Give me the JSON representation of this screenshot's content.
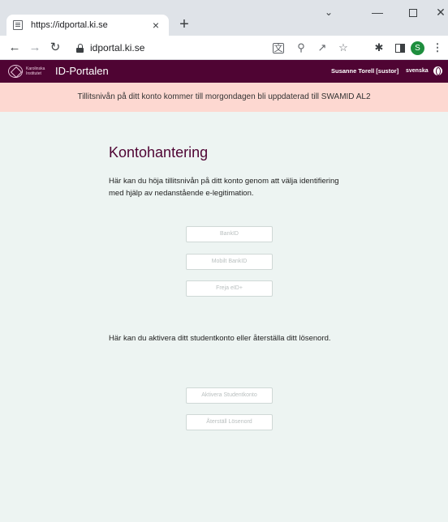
{
  "browser": {
    "tab_title": "https://idportal.ki.se",
    "tab_close": "×",
    "new_tab": "+",
    "url": "idportal.ki.se",
    "avatar_initial": "S"
  },
  "site": {
    "title": "ID-Portalen",
    "logo_text": "Karolinska Institutet",
    "user": "Susanne Torell [sustor]",
    "language": "svenska"
  },
  "notice": {
    "text": "Tillitsnivån på ditt konto kommer till morgondagen bli uppdaterad till SWAMID AL2"
  },
  "main": {
    "title": "Kontohantering",
    "intro": "Här kan du höja tillitsnivån på ditt konto genom att välja identifiering med hjälp av nedanstående e-legitimation.",
    "buttons": {
      "bankid": "BankID",
      "mobilt_bankid": "Mobilt BankID",
      "freja": "Freja eID+"
    },
    "intro2": "Här kan du aktivera ditt studentkonto eller återställa ditt lösenord.",
    "buttons2": {
      "aktivera": "Aktivera Studentkonto",
      "aterstall": "Återställ Lösenord"
    }
  },
  "colors": {
    "brand": "#4f0433",
    "notice_bg": "#fdd8d1",
    "page_bg": "#edf4f2"
  }
}
